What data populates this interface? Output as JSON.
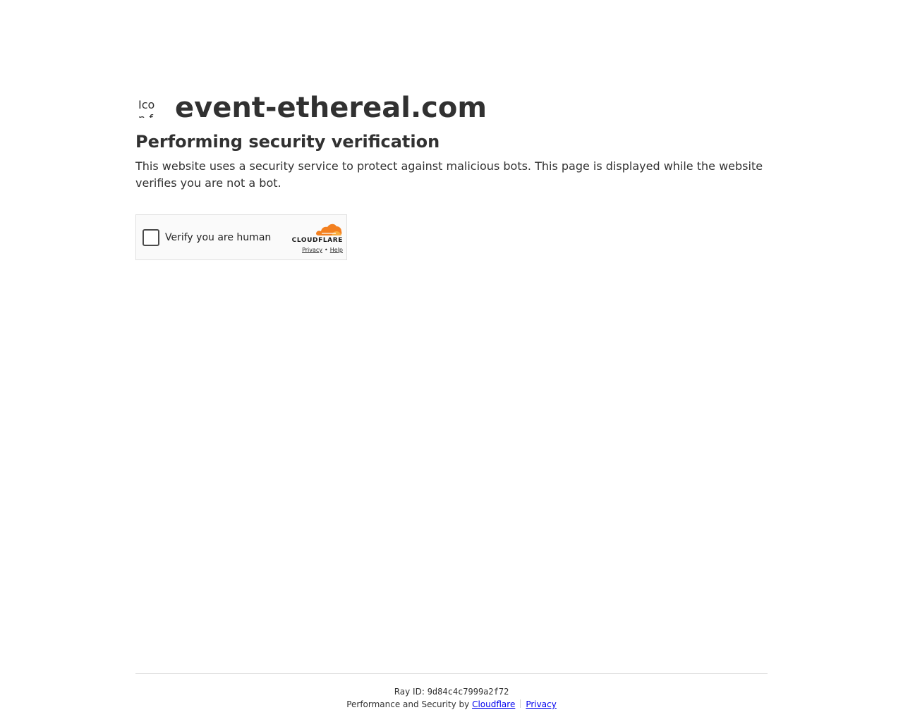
{
  "site": {
    "favicon_alt": "Icon for",
    "name": "event-ethereal.com"
  },
  "main": {
    "heading": "Performing security verification",
    "description": "This website uses a security service to protect against malicious bots. This page is displayed while the website verifies you are not a bot."
  },
  "widget": {
    "label": "Verify you are human",
    "brand": "CLOUDFLARE",
    "privacy_link": "Privacy",
    "separator": "•",
    "help_link": "Help",
    "brand_color": "#f38020"
  },
  "footer": {
    "ray_label": "Ray ID:",
    "ray_id": "9d84c4c7999a2f72",
    "performance_text": "Performance and Security by",
    "cloudflare_link": "Cloudflare",
    "privacy_link": "Privacy"
  }
}
